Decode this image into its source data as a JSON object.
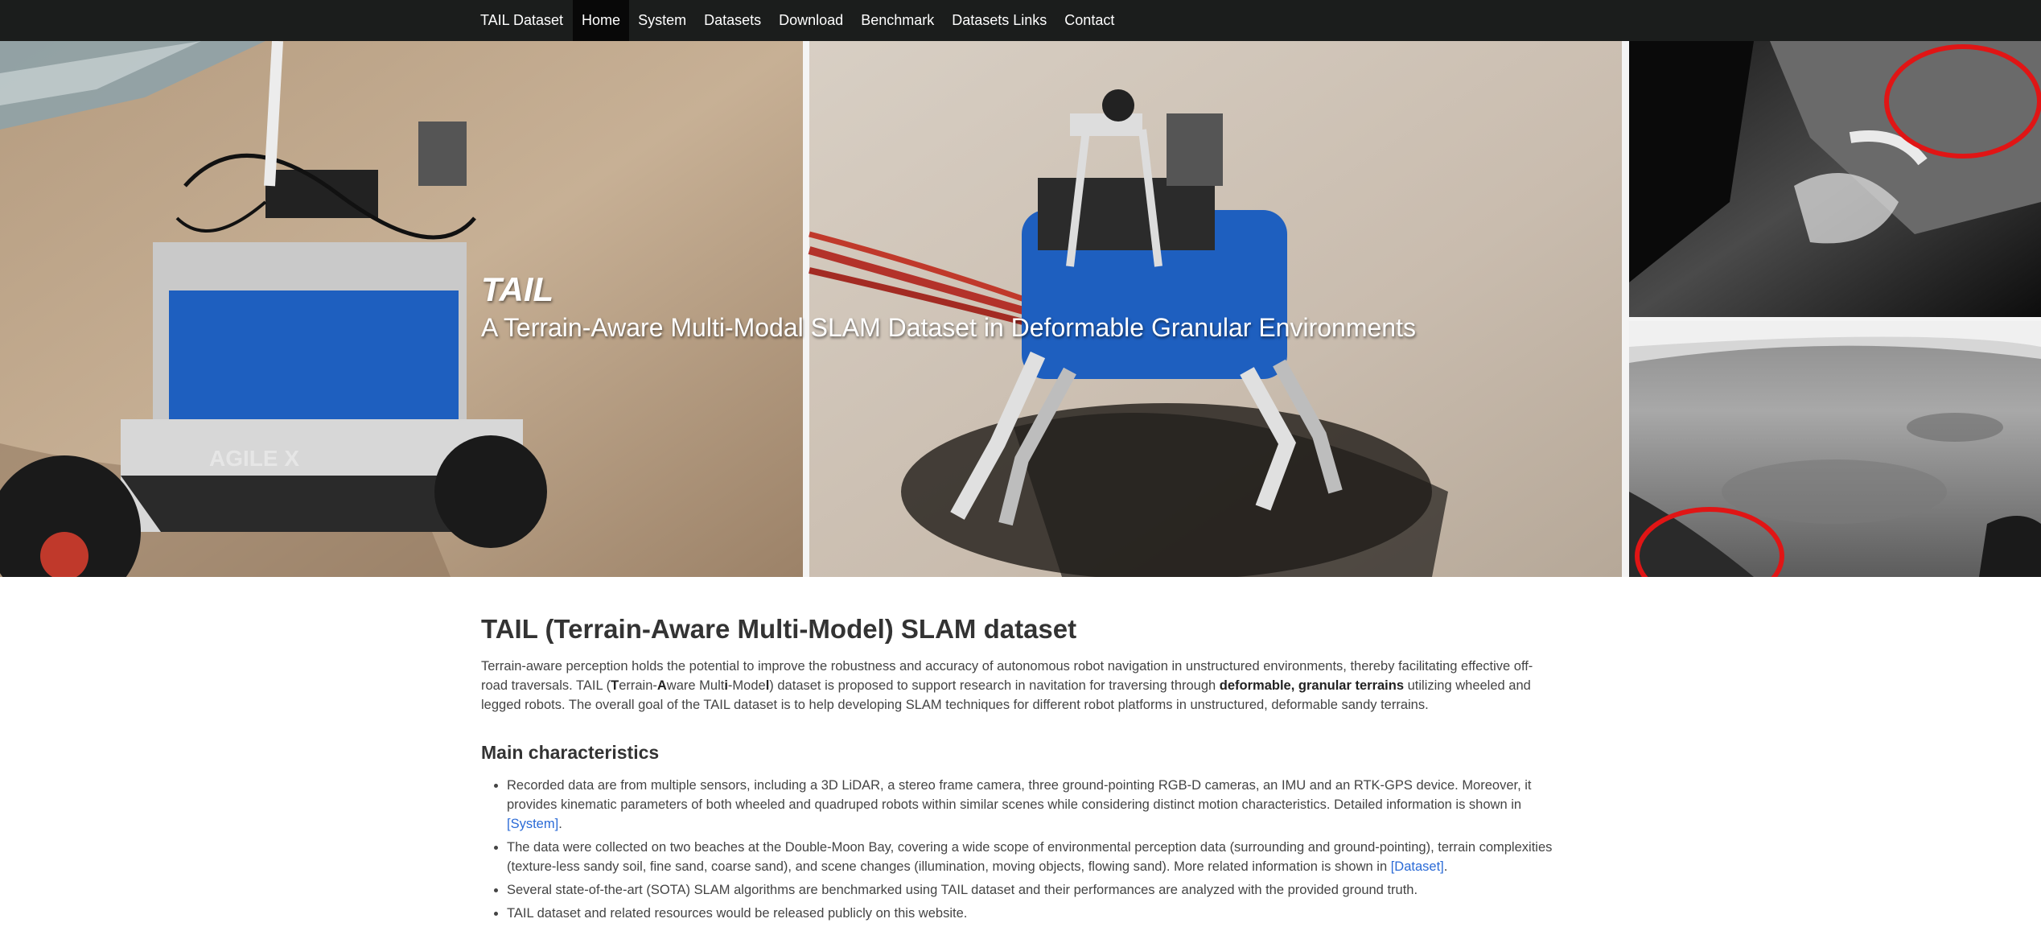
{
  "nav": {
    "brand": "TAIL Dataset",
    "items": [
      "Home",
      "System",
      "Datasets",
      "Download",
      "Benchmark",
      "Datasets Links",
      "Contact"
    ],
    "active": "Home"
  },
  "hero": {
    "title": "TAIL",
    "subtitle": "A Terrain-Aware Multi-Modal SLAM Dataset in Deformable Granular Environments",
    "robot_logo_text": "AGILE X"
  },
  "intro": {
    "heading": "TAIL (Terrain-Aware Multi-Model) SLAM dataset",
    "p1": "Terrain-aware perception holds the potential to improve the robustness and accuracy of autonomous robot navigation in unstructured environments, thereby facilitating effective off-road traversals. TAIL (",
    "t": "T",
    "p2": "errain-",
    "a": "A",
    "p3": "ware Mult",
    "i": "i",
    "p4": "-Mode",
    "l": "l",
    "p5": ") dataset is proposed to support research in navitation for traversing through ",
    "bold_terrain": "deformable, granular terrains",
    "p6": " utilizing wheeled and legged robots. The overall goal of the TAIL dataset is to help developing SLAM techniques for different robot platforms in unstructured, deformable sandy terrains."
  },
  "characteristics": {
    "heading": "Main characteristics",
    "items": [
      {
        "text": "Recorded data are from multiple sensors, including a 3D LiDAR, a stereo frame camera, three ground-pointing RGB-D cameras, an IMU and an RTK-GPS device. Moreover, it provides kinematic parameters of both wheeled and quadruped robots within similar scenes while considering distinct motion characteristics. Detailed information is shown in ",
        "link": "[System]",
        "after": "."
      },
      {
        "text": "The data were collected on two beaches at the Double-Moon Bay, covering a wide scope of environmental perception data (surrounding and ground-pointing), terrain complexities (texture-less sandy soil, fine sand, coarse sand), and scene changes (illumination, moving objects, flowing sand). More related information is shown in ",
        "link": "[Dataset]",
        "after": "."
      },
      {
        "text": "Several state-of-the-art (SOTA) SLAM algorithms are benchmarked using TAIL dataset and their performances are analyzed with the provided ground truth.",
        "link": "",
        "after": ""
      },
      {
        "text": "TAIL dataset and related resources would be released publicly on this website.",
        "link": "",
        "after": ""
      }
    ]
  },
  "colors": {
    "navbar_bg": "#1b1d1c",
    "link": "#2a6ad6",
    "text": "#444444"
  }
}
